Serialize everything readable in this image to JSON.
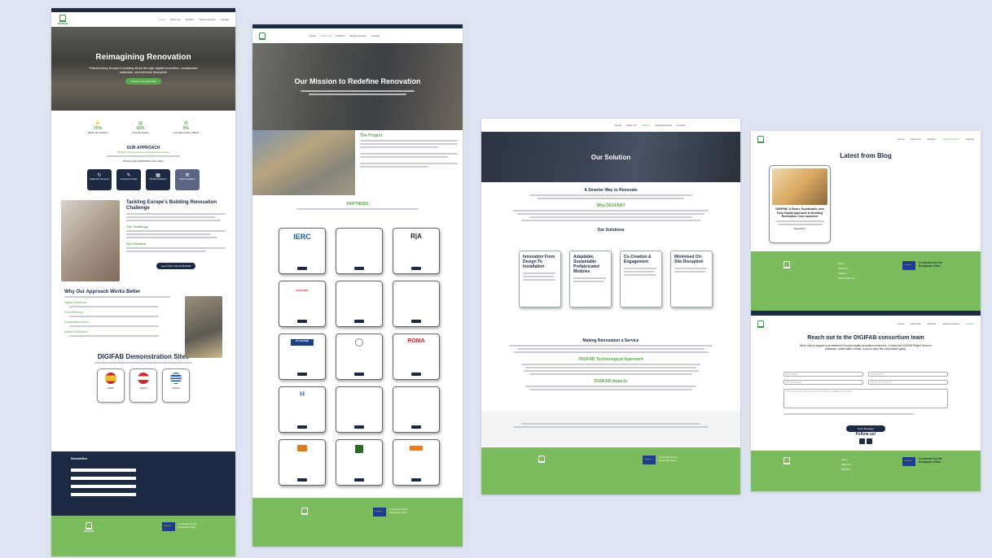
{
  "nav": {
    "items": [
      "Home",
      "About Us",
      "Solution",
      "News & Events",
      "Contact"
    ],
    "logo_text": "DIGIFAB"
  },
  "page1": {
    "hero_title": "Reimagining Renovation",
    "hero_subtitle": "Transforming Europe's building stock through digital innovation, sustainable materials, and minimal disruption",
    "hero_button": "Discover Our Approach",
    "stats": [
      {
        "value": "70%",
        "label": "Faster Renovation"
      },
      {
        "value": "60%",
        "label": "Cost Reduction"
      },
      {
        "value": "0%",
        "label": "Less Renovation Waste"
      }
    ],
    "approach_title": "OUR APPROACH",
    "approach_subtitle": "Bringing Digital Solutions to Building Renovation",
    "process_label": "Discover the DIGIFAB Process Steps",
    "steps": [
      "Digital Site Surveying",
      "Component Design",
      "Off-Site Production",
      "Rapid Installation"
    ],
    "challenge_title": "Tackling Europe's Building Renovation Challenge",
    "challenge_label": "The Challenge",
    "solution_label": "Our Solution",
    "challenge_button": "Learn More About DIGIFAB",
    "why_title": "Why Our Approach Works Better",
    "why_items": [
      "Digital Excellence",
      "Cost Efficiency",
      "Sustainable Impact",
      "Minimal Disruption"
    ],
    "sites_title": "DIGIFAB Demonstration Sites",
    "sites": [
      "Spain",
      "Austria",
      "Greece"
    ],
    "newsletter_title": "Newsletter",
    "footer_eu": "Co-funded by the European Union"
  },
  "page2": {
    "hero_title": "Our Mission to Redefine Renovation",
    "project_title": "The Project",
    "partners_title": "PARTNERS",
    "partners": [
      "IERC",
      "",
      "R|A",
      "acciona",
      "",
      "",
      "EU LEATHER",
      "",
      "ROMA",
      "",
      "",
      "",
      "",
      "",
      ""
    ],
    "footer_eu": "Co-funded by the European Union"
  },
  "page3": {
    "hero_title": "Our Solution",
    "smarter_title": "A Smarter Way to Renovate",
    "why_title": "Why DIGIFAB?",
    "solutions_title": "Our Solutions",
    "solutions": [
      "Innovation From Design To Installation",
      "Adaptable, Sustainable Prefabricated Modules",
      "Co-Creation & Engagement",
      "Minimised On-Site Disruption"
    ],
    "service_title": "Making Renovation a Service",
    "tech_title": "DIGIFAB Technological Approach",
    "impacts_title": "DIGIFAB Impacts",
    "footer_eu": "Co-funded by the European Union"
  },
  "page4": {
    "blog_title": "Latest from Blog",
    "blog_card_title": "DIGIFAB: A Smart, Sustainable, and Fully Digital Approach to Building Renovation Just Launched",
    "blog_card_link": "Read More",
    "footer_eu": "Co-funded by the European Union"
  },
  "page5": {
    "contact_title": "Reach out to the DIGIFAB consortium team",
    "contact_intro": "We're here to support your interest in Europe's digital renovation movement. Contact the DIGIFAB Project Team for questions, collaboration, media, or just to keep the conversation going.",
    "fields": [
      "First Name",
      "Last Name",
      "Email Address",
      "Name of Company"
    ],
    "message_placeholder": "Tell us how we can support your interest in collaboration here",
    "send_button": "Send Message",
    "follow_title": "Follow us!",
    "footer_eu": "Co-funded by the European Union"
  },
  "colors": {
    "accent_green": "#5aa84c",
    "navy": "#1c2a44",
    "footer_green": "#7bbd5c",
    "background": "#dde3f1"
  }
}
